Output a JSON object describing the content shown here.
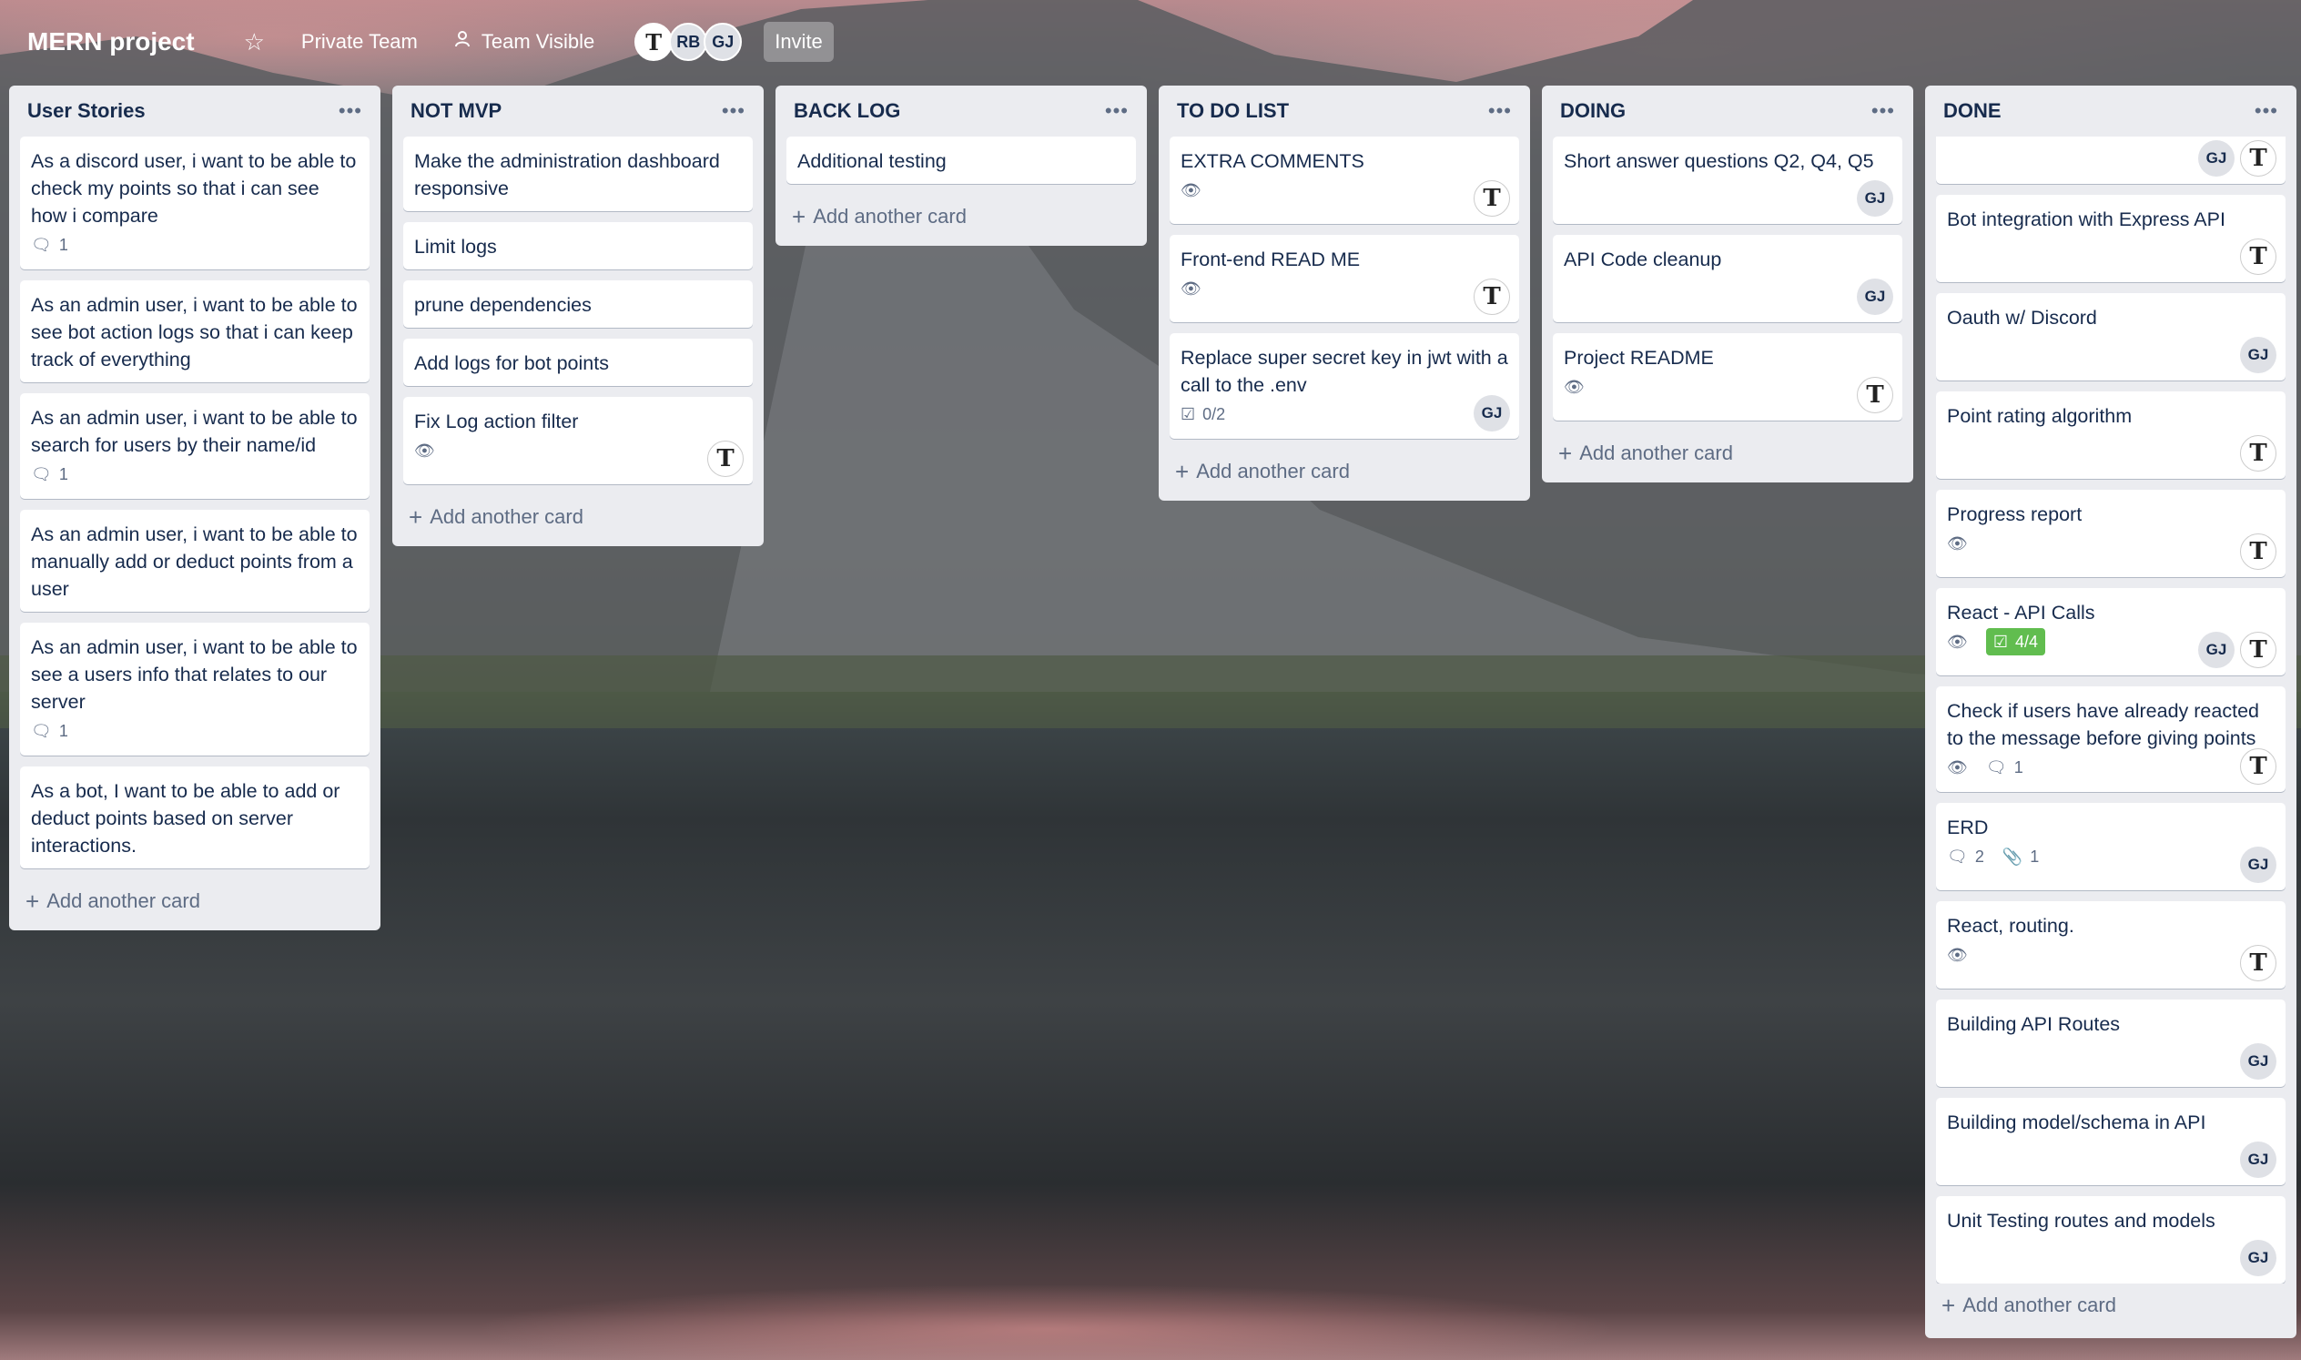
{
  "header": {
    "board_title": "MERN project",
    "star_icon": "star-icon",
    "team_label": "Private Team",
    "visibility_label": "Team Visible",
    "members": [
      "T",
      "RB",
      "GJ"
    ],
    "invite_label": "Invite"
  },
  "lists": {
    "user_stories": {
      "title": "User Stories",
      "cards": [
        {
          "text": "As a discord user, i want to be able to check my points so that i can see how i compare",
          "comments": "1"
        },
        {
          "text": "As an admin user, i want to be able to see bot action logs so that i can keep track of everything"
        },
        {
          "text": "As an admin user, i want to be able to search for users by their name/id",
          "comments": "1"
        },
        {
          "text": "As an admin user, i want to be able to manually add or deduct points from a user"
        },
        {
          "text": "As an admin user, i want to be able to see a users info that relates to our server",
          "comments": "1"
        },
        {
          "text": "As a bot, I want to be able to add or deduct points based on server interactions."
        }
      ],
      "add_label": "Add another card"
    },
    "not_mvp": {
      "title": "NOT MVP",
      "cards": [
        {
          "text": "Make the administration dashboard responsive"
        },
        {
          "text": "Limit logs"
        },
        {
          "text": "prune dependencies"
        },
        {
          "text": "Add logs for bot points"
        },
        {
          "text": "Fix Log action filter",
          "member": "T"
        }
      ],
      "add_label": "Add another card"
    },
    "back_log": {
      "title": "BACK LOG",
      "cards": [
        {
          "text": "Additional testing"
        }
      ],
      "add_label": "Add another card"
    },
    "to_do": {
      "title": "TO DO LIST",
      "cards": [
        {
          "text": "EXTRA COMMENTS",
          "member": "T"
        },
        {
          "text": "Front-end READ ME",
          "member": "T"
        },
        {
          "text": "Replace super secret key in jwt with a call to the .env",
          "checklist": "0/2",
          "member": "GJ"
        }
      ],
      "add_label": "Add another card"
    },
    "doing": {
      "title": "DOING",
      "cards": [
        {
          "text": "Short answer questions Q2, Q4, Q5",
          "member": "GJ"
        },
        {
          "text": "API Code cleanup",
          "member": "GJ"
        },
        {
          "text": "Project README",
          "member": "T"
        }
      ],
      "add_label": "Add another card"
    },
    "done": {
      "title": "DONE",
      "cards": [
        {
          "text": "",
          "members": [
            "GJ",
            "T"
          ]
        },
        {
          "text": "Bot integration with Express API",
          "member": "T"
        },
        {
          "text": "Oauth w/ Discord",
          "member": "GJ"
        },
        {
          "text": "Point rating algorithm",
          "member": "T"
        },
        {
          "text": "Progress report",
          "member": "T"
        },
        {
          "text": "React - API Calls",
          "checklist": "4/4",
          "members": [
            "GJ",
            "T"
          ]
        },
        {
          "text": "Check if users have already reacted to the message before giving points",
          "comments": "1",
          "member": "T"
        },
        {
          "text": "ERD",
          "comments": "2",
          "attachments": "1",
          "member": "GJ"
        },
        {
          "text": "React, routing.",
          "member": "T"
        },
        {
          "text": "Building API Routes",
          "member": "GJ"
        },
        {
          "text": "Building model/schema in API",
          "member": "GJ"
        },
        {
          "text": "Unit Testing routes and models",
          "member": "GJ"
        }
      ],
      "add_label": "Add another card"
    }
  }
}
